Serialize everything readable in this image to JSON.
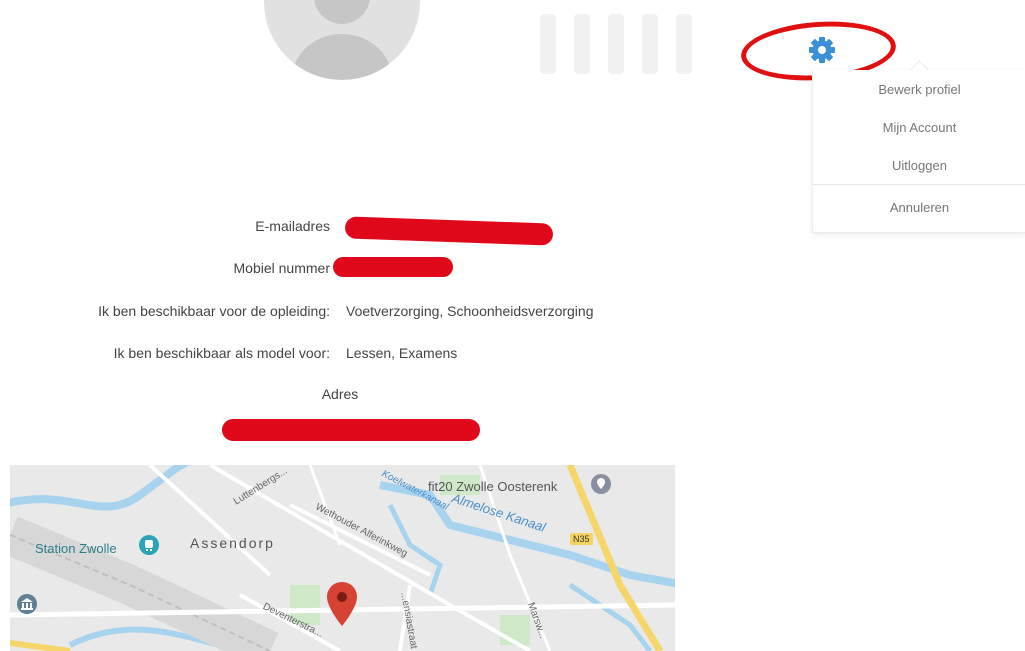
{
  "menu": {
    "items": [
      "Bewerk profiel",
      "Mijn Account",
      "Uitloggen"
    ],
    "cancel": "Annuleren"
  },
  "profile": {
    "email_label": "E-mailadres",
    "mobile_label": "Mobiel nummer",
    "training_label": "Ik ben beschikbaar voor de opleiding:",
    "training_value": "Voetverzorging, Schoonheidsverzorging",
    "model_label": "Ik ben beschikbaar als model voor:",
    "model_value": "Lessen, Examens",
    "address_heading": "Adres"
  },
  "map": {
    "labels": {
      "fit20": "fit20 Zwolle Oosterenk",
      "station": "Station Zwolle",
      "assendorp": "Assendorp",
      "wethouder": "Wethouder Alferinkweg",
      "almelose": "Almelose Kanaal",
      "koelwater": "Koelwaterkanaal",
      "luttenberg": "Luttenbergs...",
      "n35": "N35",
      "deventer": "Deventerstra...",
      "marsweg": "Marsw...",
      "straat": "...ensiastraat"
    }
  },
  "colors": {
    "gear": "#3a8fd8",
    "redaction": "#e0081b",
    "marker": "#d64234"
  }
}
